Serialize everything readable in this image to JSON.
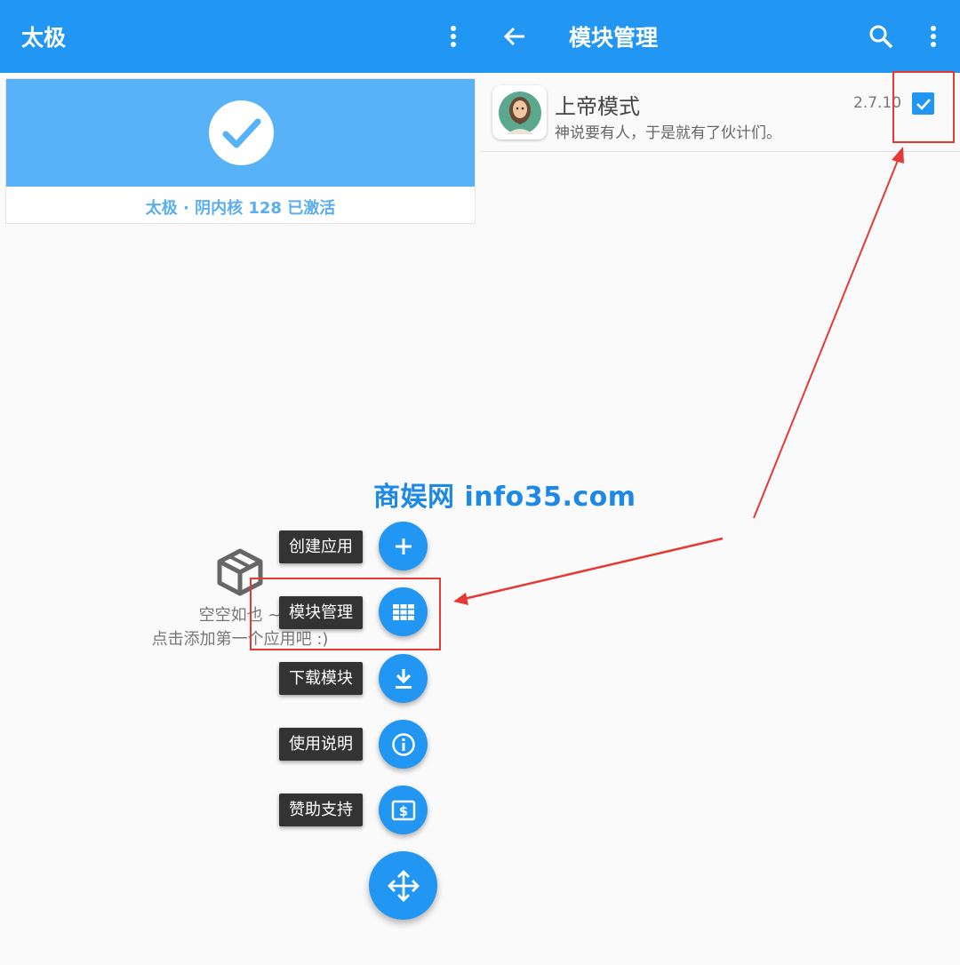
{
  "left_panel": {
    "appbar": {
      "title": "太极",
      "overflow_icon": "more-vert-icon"
    },
    "status": {
      "icon": "check-circle-icon",
      "text": "太极 · 阴内核 128 已激活"
    },
    "empty_state": {
      "icon": "open-box-icon",
      "line1": "空空如也 ~",
      "line2": "点击添加第一个应用吧 :)"
    },
    "fab_menu": [
      {
        "label": "创建应用",
        "icon": "plus-icon"
      },
      {
        "label": "模块管理",
        "icon": "grid-icon"
      },
      {
        "label": "下载模块",
        "icon": "download-icon"
      },
      {
        "label": "使用说明",
        "icon": "info-icon"
      },
      {
        "label": "赞助支持",
        "icon": "dollar-icon"
      }
    ],
    "main_fab_icon": "move-icon"
  },
  "right_panel": {
    "appbar": {
      "title": "模块管理",
      "back_icon": "arrow-back-icon",
      "search_icon": "search-icon",
      "overflow_icon": "more-vert-icon"
    },
    "modules": [
      {
        "name": "上帝模式",
        "description": "神说要有人，于是就有了伙计们。",
        "version": "2.7.10",
        "enabled": true,
        "icon": "god-face-icon"
      }
    ]
  },
  "watermark": "商娱网 info35.com",
  "colors": {
    "primary": "#2196f3",
    "status_banner": "#58b2f7",
    "annotation": "#e53935"
  }
}
